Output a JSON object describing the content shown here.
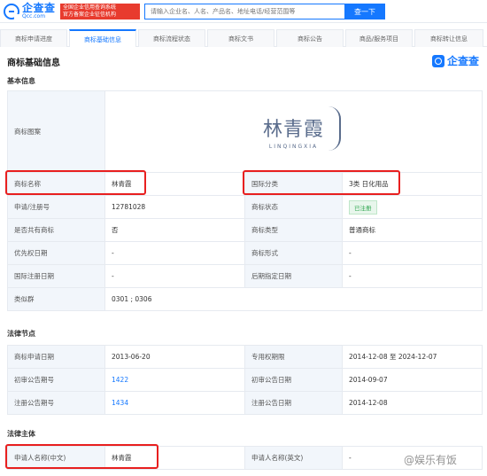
{
  "header": {
    "logo_cn": "企查查",
    "logo_en": "Qcc.com",
    "slogan_line1": "全国企业信用查询系统",
    "slogan_line2": "官方备案企业征信机构",
    "search_placeholder": "请输入企业名、人名、产品名、地址电话/经营范围等",
    "search_button": "查一下"
  },
  "tabs": [
    {
      "label": "商标申请进度",
      "active": false
    },
    {
      "label": "商标基础信息",
      "active": true
    },
    {
      "label": "商标流程状态",
      "active": false
    },
    {
      "label": "商标文书",
      "active": false
    },
    {
      "label": "商标公告",
      "active": false
    },
    {
      "label": "商品/服务项目",
      "active": false
    },
    {
      "label": "商标转让信息",
      "active": false
    }
  ],
  "section_title": "商标基础信息",
  "qcc_badge": "企查查",
  "basic_info": {
    "title": "基本信息",
    "image_label": "商标图案",
    "brand_cn": "林青霞",
    "brand_en": "LINQINGXIA",
    "rows": [
      {
        "l1": "商标名称",
        "v1": "林青霞",
        "l2": "国际分类",
        "v2": "3类 日化用品"
      },
      {
        "l1": "申请/注册号",
        "v1": "12781028",
        "l2": "商标状态",
        "v2": "已注册"
      },
      {
        "l1": "是否共有商标",
        "v1": "否",
        "l2": "商标类型",
        "v2": "普通商标"
      },
      {
        "l1": "优先权日期",
        "v1": "-",
        "l2": "商标形式",
        "v2": "-"
      },
      {
        "l1": "国际注册日期",
        "v1": "-",
        "l2": "后期指定日期",
        "v2": "-"
      }
    ],
    "similar_label": "类似群",
    "similar_value": "0301 ; 0306"
  },
  "legal_dates": {
    "title": "法律节点",
    "rows": [
      {
        "l1": "商标申请日期",
        "v1": "2013-06-20",
        "l2": "专用权期限",
        "v2": "2014-12-08 至 2024-12-07"
      },
      {
        "l1": "初审公告期号",
        "v1": "1422",
        "l2": "初审公告日期",
        "v2": "2014-09-07"
      },
      {
        "l1": "注册公告期号",
        "v1": "1434",
        "l2": "注册公告日期",
        "v2": "2014-12-08"
      }
    ]
  },
  "legal_subject": {
    "title": "法律主体",
    "l1": "申请人名称(中文)",
    "v1": "林青霞",
    "l2": "申请人名称(英文)",
    "v2": "-"
  },
  "watermark": "@娱乐有饭"
}
